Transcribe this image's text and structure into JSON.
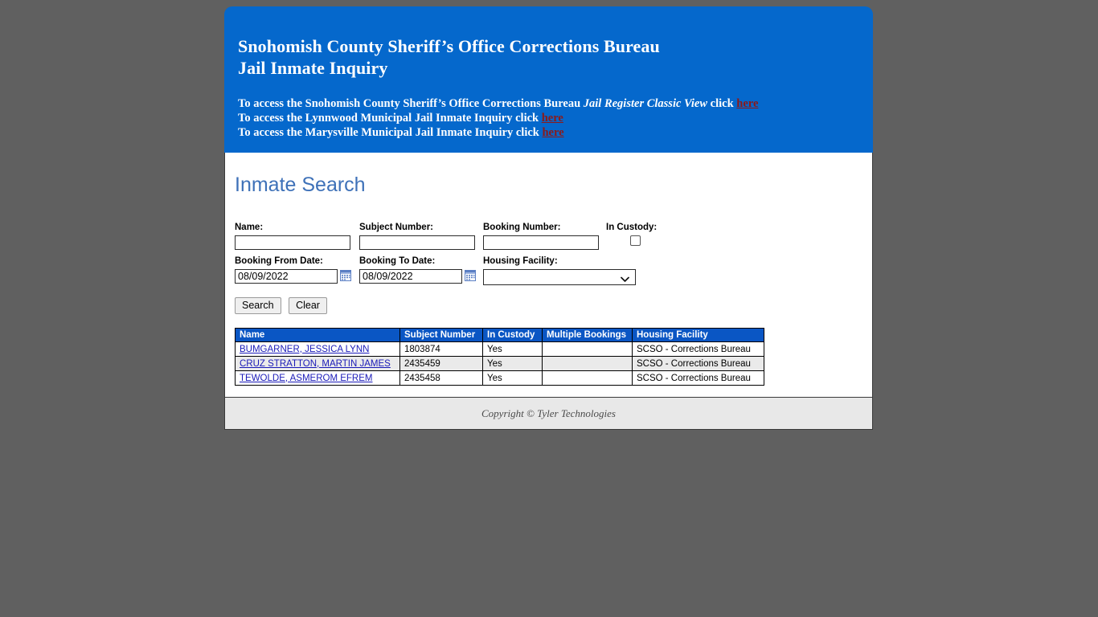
{
  "banner": {
    "title_line1": "Snohomish County Sheriff’s Office Corrections Bureau",
    "title_line2": "Jail Inmate Inquiry",
    "link_line1_pre": "To access the Snohomish County Sheriff’s Office Corrections Bureau ",
    "link_line1_italic": "Jail Register Classic View",
    "link_line1_mid": " click ",
    "link_line1_link": "here",
    "link_line2_pre": "To access the Lynnwood Municipal Jail Inmate Inquiry click ",
    "link_line2_link": "here",
    "link_line3_pre": "To access the Marysville Municipal Jail Inmate Inquiry click ",
    "link_line3_link": "here",
    "background_color": "#0568CC",
    "link_color": "#8B1A1A"
  },
  "page": {
    "title": "Inmate Search",
    "title_color": "#3E71B8"
  },
  "form": {
    "name_label": "Name:",
    "name_value": "",
    "name_placeholder": "",
    "subject_label": "Subject Number:",
    "subject_value": "",
    "subject_placeholder": "",
    "booking_label": "Booking Number:",
    "booking_value": "",
    "booking_placeholder": "",
    "in_custody_label": "In Custody:",
    "in_custody_checked": false,
    "booking_from_label": "Booking From Date:",
    "booking_from_value": "08/09/2022",
    "booking_to_label": "Booking To Date:",
    "booking_to_value": "08/09/2022",
    "housing_label": "Housing Facility:",
    "housing_selected": "",
    "housing_options": [
      ""
    ],
    "calendar_icon": "calendar-icon",
    "dropdown_icon": "chevron-down-icon",
    "search_button": "Search",
    "clear_button": "Clear"
  },
  "results": {
    "columns": [
      "Name",
      "Subject Number",
      "In Custody",
      "Multiple Bookings",
      "Housing Facility"
    ],
    "header_color": "#0A56C4",
    "rows": [
      {
        "name": "BUMGARNER, JESSICA LYNN",
        "subject_number": "1803874",
        "in_custody": "Yes",
        "multiple_bookings": "",
        "housing_facility": "SCSO - Corrections Bureau"
      },
      {
        "name": "CRUZ STRATTON, MARTIN JAMES",
        "subject_number": "2435459",
        "in_custody": "Yes",
        "multiple_bookings": "",
        "housing_facility": "SCSO - Corrections Bureau"
      },
      {
        "name": "TEWOLDE, ASMEROM EFREM",
        "subject_number": "2435458",
        "in_custody": "Yes",
        "multiple_bookings": "",
        "housing_facility": "SCSO - Corrections Bureau"
      }
    ]
  },
  "footer": {
    "copyright": "Copyright © Tyler Technologies"
  }
}
